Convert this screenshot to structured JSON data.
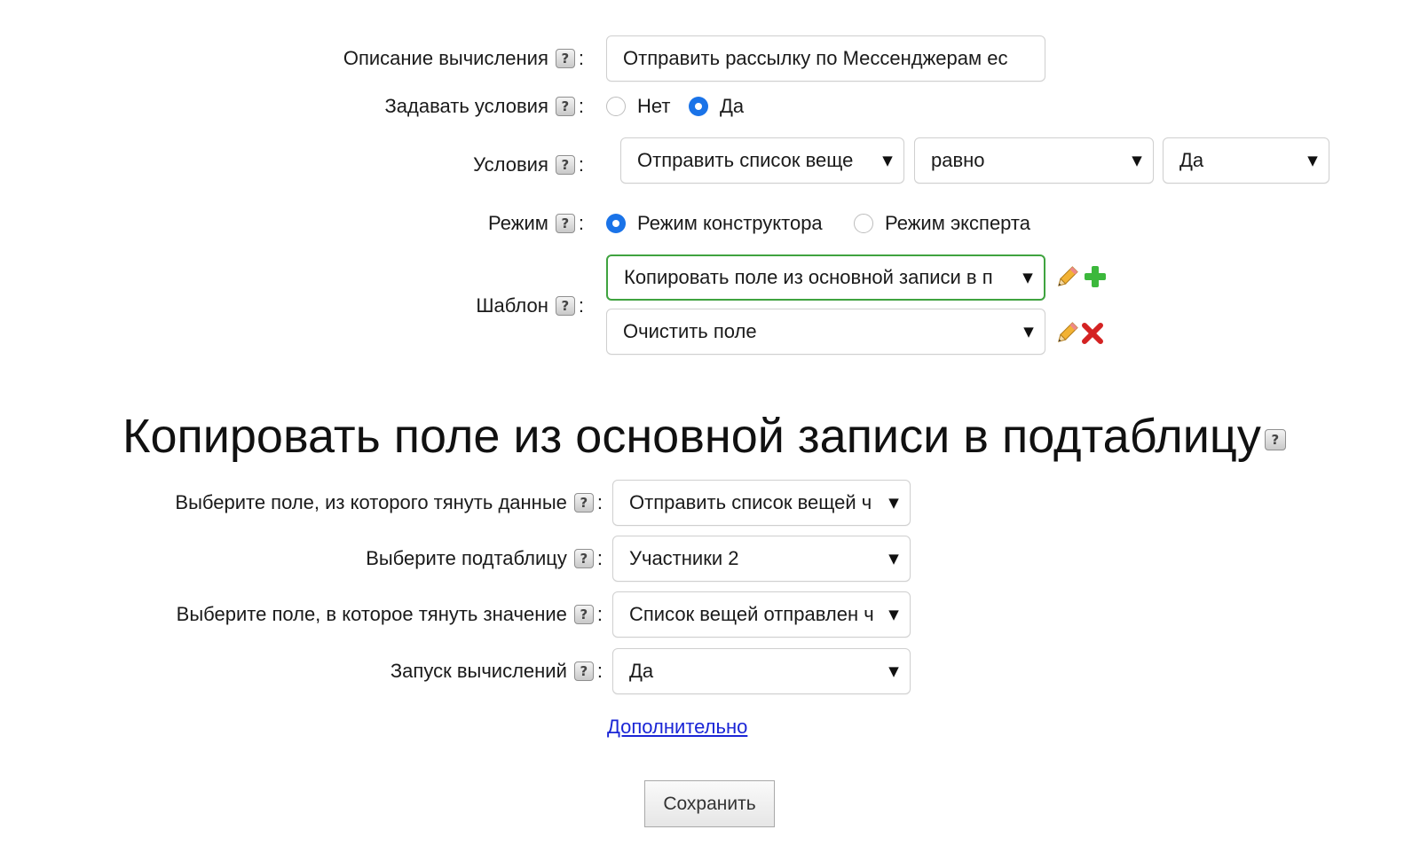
{
  "form": {
    "description": {
      "label": "Описание вычисления",
      "help": "?",
      "value": "Отправить рассылку по Мессенджерам ес"
    },
    "set_conditions": {
      "label": "Задавать условия",
      "help": "?",
      "options": [
        "Нет",
        "Да"
      ],
      "selected": "Да"
    },
    "conditions": {
      "label": "Условия",
      "help": "?",
      "field": "Отправить список веще",
      "operator": "равно",
      "value": "Да"
    },
    "mode": {
      "label": "Режим",
      "help": "?",
      "options": [
        "Режим конструктора",
        "Режим эксперта"
      ],
      "selected": "Режим конструктора"
    },
    "template": {
      "label": "Шаблон",
      "help": "?",
      "items": [
        "Копировать поле из основной записи в п",
        "Очистить поле"
      ]
    }
  },
  "section": {
    "title": "Копировать поле из основной записи в подтаблицу",
    "help": "?",
    "fields": [
      {
        "label": "Выберите поле, из которого тянуть данные",
        "help": "?",
        "value": "Отправить список вещей ч"
      },
      {
        "label": "Выберите подтаблицу",
        "help": "?",
        "value": "Участники 2"
      },
      {
        "label": "Выберите поле, в которое тянуть значение",
        "help": "?",
        "value": "Список вещей отправлен ч"
      },
      {
        "label": "Запуск вычислений",
        "help": "?",
        "value": "Да"
      }
    ],
    "more_link": "Дополнительно",
    "save_button": "Сохранить"
  },
  "icons": {
    "arrow": "▼",
    "edit": "pencil-icon",
    "add": "plus-icon",
    "remove": "cross-icon"
  },
  "colors": {
    "accent": "#1a73e8",
    "link": "#1a25d6",
    "add": "#3cb83c",
    "remove": "#d42222",
    "active_border": "#3fa33f"
  }
}
